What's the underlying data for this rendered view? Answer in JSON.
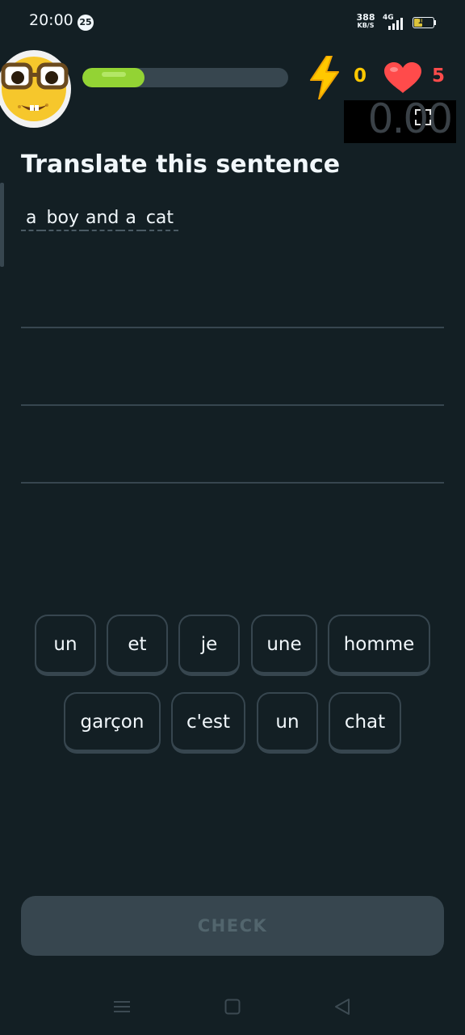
{
  "status_bar": {
    "time": "20:00",
    "notification_count": "25",
    "net_speed_value": "388",
    "net_speed_unit": "KB/S",
    "network_type": "4G",
    "battery_level": "19"
  },
  "header": {
    "progress_percent": 30,
    "streak_count": "0",
    "hearts_count": "5",
    "timer_value": "0.00"
  },
  "lesson": {
    "title": "Translate this sentence",
    "prompt_words": [
      "a",
      "boy",
      "and",
      "a",
      "cat"
    ]
  },
  "word_bank": {
    "row1": [
      "un",
      "et",
      "je",
      "une",
      "homme"
    ],
    "row2": [
      "garçon",
      "c'est",
      "un",
      "chat"
    ]
  },
  "actions": {
    "check_label": "CHECK"
  },
  "icons": {
    "mascot": "nerd-face-mascot-icon",
    "streak": "lightning-bolt-icon",
    "hearts": "heart-icon",
    "expand": "expand-icon",
    "nav_menu": "menu-icon",
    "nav_home": "home-square-icon",
    "nav_back": "back-triangle-icon"
  },
  "colors": {
    "background": "#131f24",
    "progress": "#93d334",
    "streak": "#ffc800",
    "hearts": "#ff4b4b",
    "chip_border": "#37464f",
    "check_disabled": "#37464f"
  }
}
